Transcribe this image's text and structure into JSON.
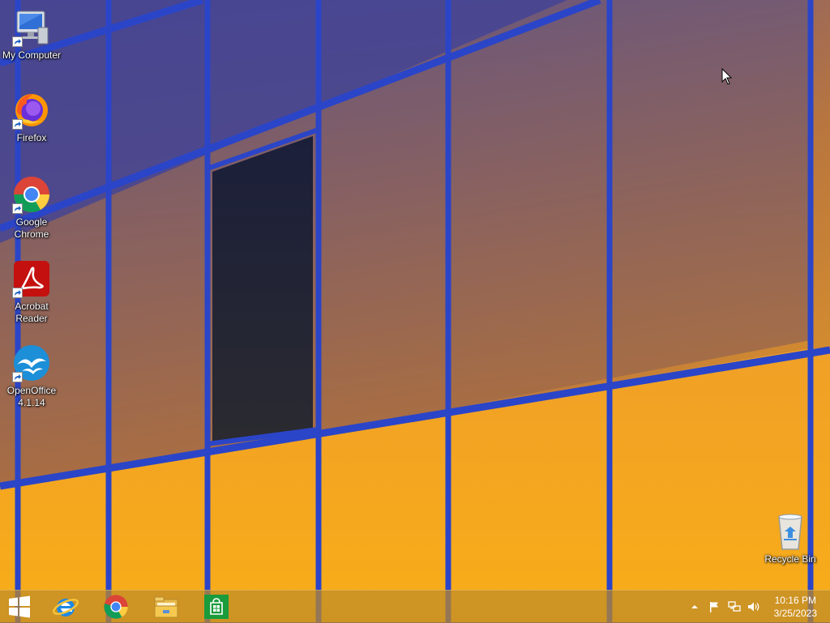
{
  "desktop": {
    "icons": [
      {
        "label": "My Computer",
        "icon": "my-computer-icon"
      },
      {
        "label": "Firefox",
        "icon": "firefox-icon"
      },
      {
        "label": "Google\nChrome",
        "icon": "chrome-icon"
      },
      {
        "label": "Acrobat\nReader",
        "icon": "acrobat-reader-icon"
      },
      {
        "label": "OpenOffice\n4.1.14",
        "icon": "openoffice-icon"
      },
      {
        "label": "Recycle Bin",
        "icon": "recycle-bin-icon"
      }
    ]
  },
  "taskbar": {
    "pinned": [
      {
        "name": "start-button",
        "icon": "windows-logo-icon"
      },
      {
        "name": "internet-explorer",
        "icon": "internet-explorer-icon"
      },
      {
        "name": "google-chrome",
        "icon": "chrome-icon"
      },
      {
        "name": "file-explorer",
        "icon": "folder-icon"
      },
      {
        "name": "store",
        "icon": "store-icon"
      }
    ],
    "tray": {
      "icons": [
        "show-hidden-icons-chevron-icon",
        "action-center-flag-icon",
        "network-icon",
        "volume-icon"
      ],
      "time": "10:16 PM",
      "date": "3/25/2023"
    }
  },
  "colors": {
    "wallpaper_frame": "#2c45c4",
    "wallpaper_glass_dark": "#8a5a5e",
    "wallpaper_glass_bright": "#f5a41c",
    "taskbar": "#be8a28"
  }
}
